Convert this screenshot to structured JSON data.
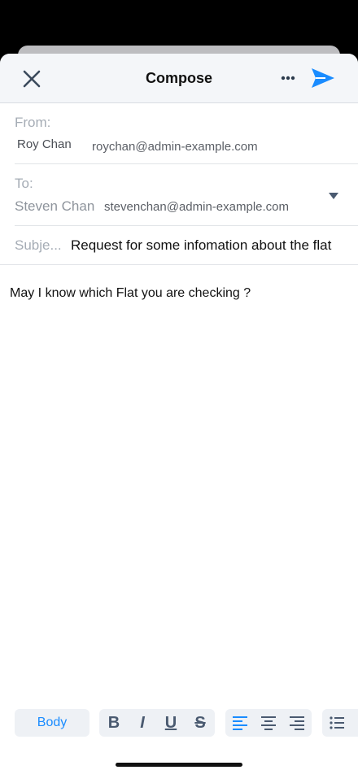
{
  "header": {
    "title": "Compose",
    "close_icon": "close-icon",
    "more_icon": "more-icon",
    "send_icon": "send-icon",
    "accent_color": "#1a8cff"
  },
  "from": {
    "label": "From:",
    "name": "Roy Chan",
    "email": "roychan@admin-example.com"
  },
  "to": {
    "label": "To:",
    "name": "Steven Chan",
    "email": "stevenchan@admin-example.com",
    "dropdown_icon": "triangle-down-icon"
  },
  "subject": {
    "label": "Subje...",
    "value": "Request for some infomation about the flat"
  },
  "body": {
    "text": "May I know which Flat you are checking ?"
  },
  "toolbar": {
    "style_label": "Body",
    "bold_label": "B",
    "italic_label": "I",
    "underline_label": "U",
    "strike_label": "S",
    "align_left_icon": "align-left-icon",
    "align_center_icon": "align-center-icon",
    "align_right_icon": "align-right-icon",
    "bullet_list_icon": "bullet-list-icon"
  }
}
